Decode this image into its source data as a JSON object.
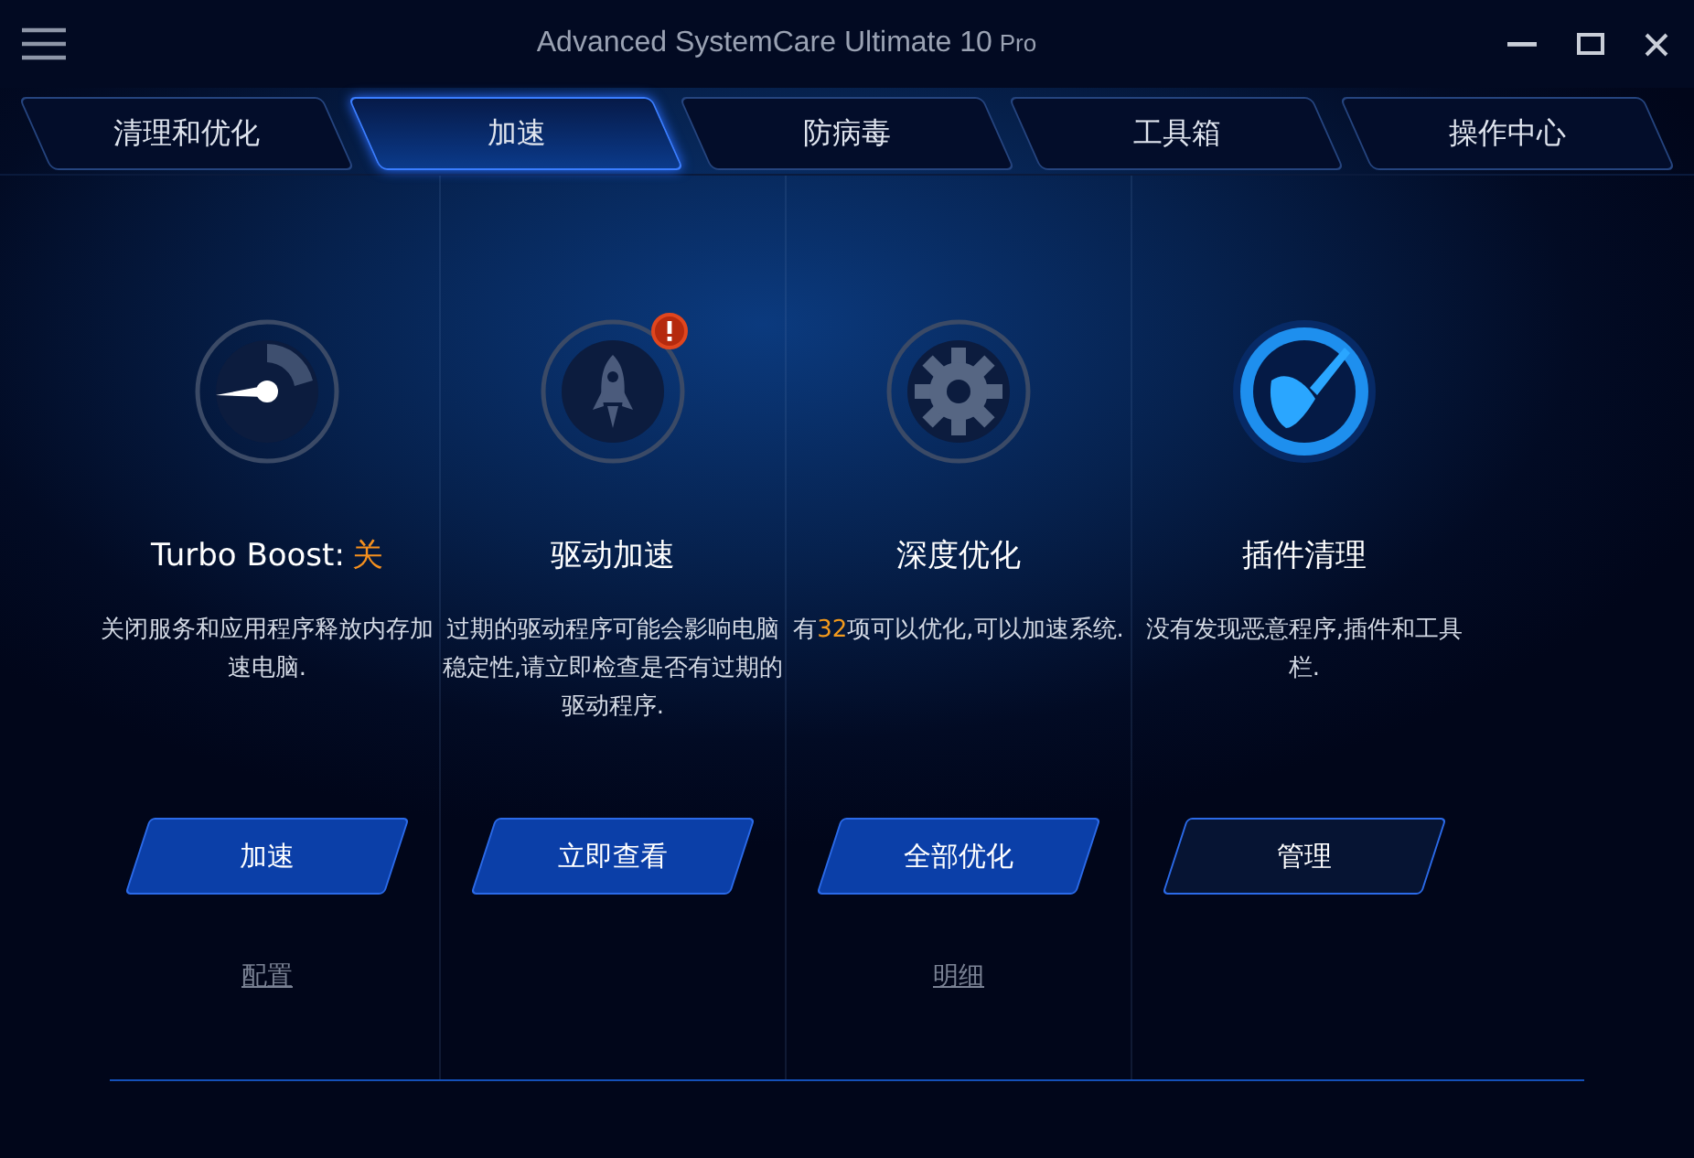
{
  "window": {
    "title": "Advanced SystemCare Ultimate 10",
    "edition": "Pro"
  },
  "tabs": [
    {
      "label": "清理和优化",
      "selected": false
    },
    {
      "label": "加速",
      "selected": true
    },
    {
      "label": "防病毒",
      "selected": false
    },
    {
      "label": "工具箱",
      "selected": false
    },
    {
      "label": "操作中心",
      "selected": false
    }
  ],
  "features": [
    {
      "kind": "gauge",
      "alert": false,
      "active": false,
      "title": "Turbo Boost:",
      "status": "关",
      "description": "关闭服务和应用程序释放内存加速电脑.",
      "button": {
        "label": "加速"
      },
      "link": "配置"
    },
    {
      "kind": "rocket",
      "alert": true,
      "active": false,
      "title": "驱动加速",
      "description": "过期的驱动程序可能会影响电脑稳定性,请立即检查是否有过期的驱动程序.",
      "button": {
        "label": "立即查看"
      }
    },
    {
      "kind": "gear",
      "alert": false,
      "active": false,
      "title": "深度优化",
      "description": "有**32**项可以优化,可以加速系统.",
      "button": {
        "label": "全部优化"
      },
      "link": "明细"
    },
    {
      "kind": "broom",
      "alert": false,
      "active": true,
      "title": "插件清理",
      "description": "没有发现恶意程序,插件和工具栏.",
      "button": {
        "label": "管理"
      }
    }
  ]
}
